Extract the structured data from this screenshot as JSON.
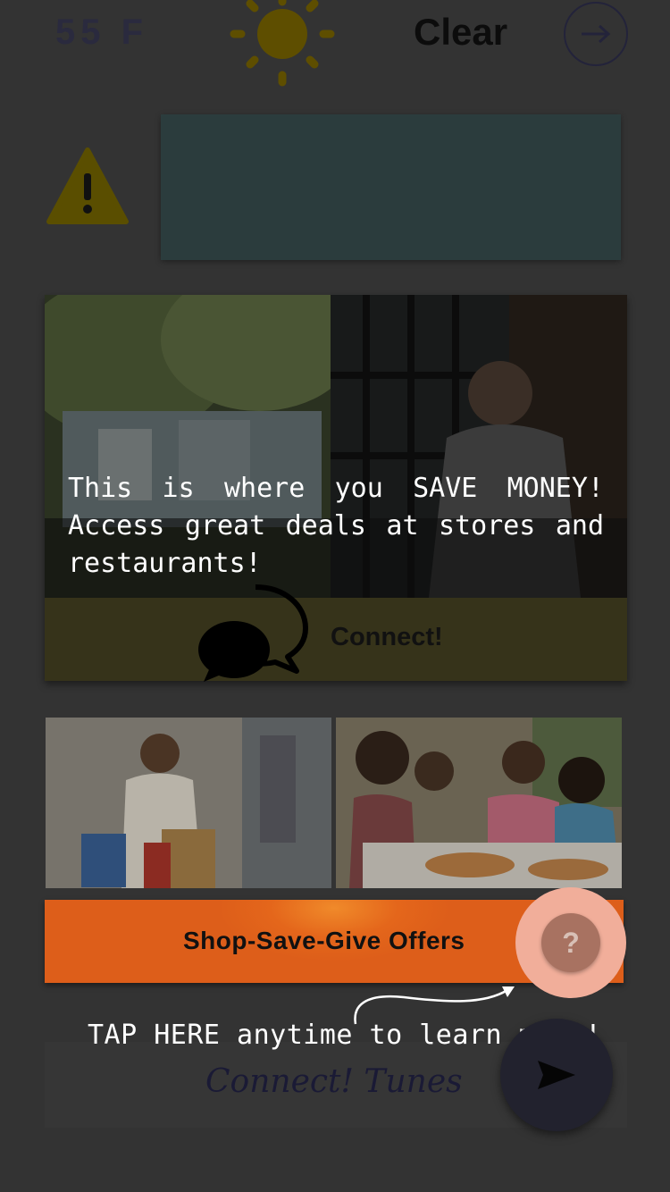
{
  "weather": {
    "temperature": "55 F",
    "condition": "Clear",
    "sun_icon": "sun-icon",
    "next_icon": "arrow-right-icon"
  },
  "alert": {
    "icon": "warning-icon",
    "panel_color": "#2b3c3d"
  },
  "save_card": {
    "message": "This is where you SAVE MONEY! Access great deals at stores and restaurants!",
    "connect_label": "Connect!",
    "chat_icon": "chat-bubbles-icon"
  },
  "tiles": [
    {
      "name": "shopping-photo"
    },
    {
      "name": "family-pizza-photo"
    }
  ],
  "offers": {
    "label": "Shop-Save-Give Offers",
    "help_symbol": "?",
    "accent": "#e4661b"
  },
  "tunes": {
    "label": "Connect! Tunes",
    "send_icon": "send-icon"
  },
  "hint": {
    "text": "TAP HERE anytime to learn more!"
  }
}
